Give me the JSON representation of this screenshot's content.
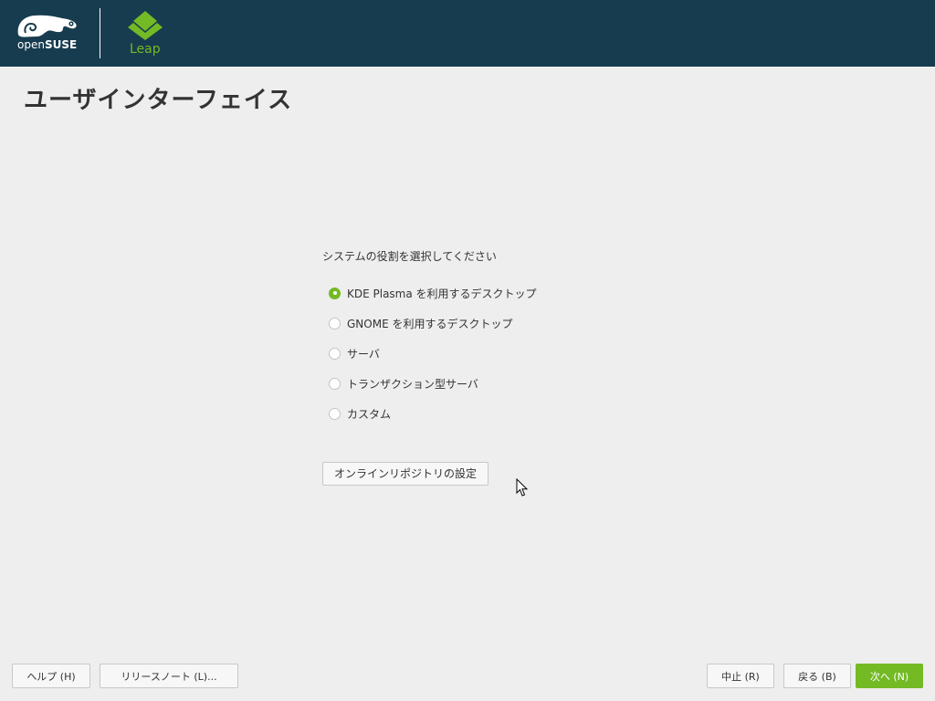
{
  "header": {
    "logo_text_open": "open",
    "logo_text_suse": "SUSE",
    "leap_text": "Leap"
  },
  "page": {
    "title": "ユーザインターフェイス"
  },
  "role_selection": {
    "question": "システムの役割を選択してください",
    "options": [
      {
        "label": "KDE Plasma を利用するデスクトップ",
        "selected": true
      },
      {
        "label": "GNOME を利用するデスクトップ",
        "selected": false
      },
      {
        "label": "サーバ",
        "selected": false
      },
      {
        "label": "トランザクション型サーバ",
        "selected": false
      },
      {
        "label": "カスタム",
        "selected": false
      }
    ],
    "repo_button": "オンラインリポジトリの設定"
  },
  "footer": {
    "help": "ヘルプ (H)",
    "release_notes": "リリースノート (L)...",
    "abort": "中止 (R)",
    "back": "戻る (B)",
    "next": "次へ (N)"
  },
  "colors": {
    "header_bg": "#173c4f",
    "accent_green": "#73ba25",
    "page_bg": "#eeeeee"
  }
}
